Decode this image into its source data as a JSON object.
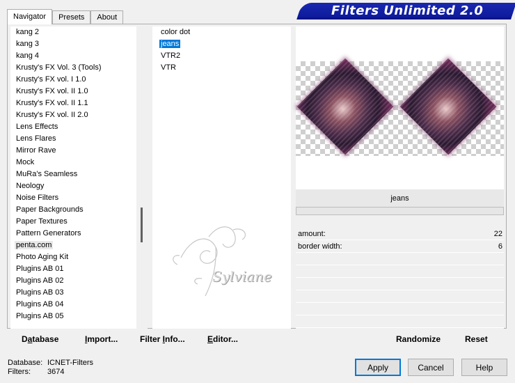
{
  "window": {
    "title": "Filters Unlimited 2.0"
  },
  "tabs": [
    {
      "label": "Navigator",
      "active": true
    },
    {
      "label": "Presets",
      "active": false
    },
    {
      "label": "About",
      "active": false
    }
  ],
  "categories": [
    "kang 2",
    "kang 3",
    "kang 4",
    "Krusty's FX Vol. 3 (Tools)",
    "Krusty's FX vol. I 1.0",
    "Krusty's FX vol. II 1.0",
    "Krusty's FX vol. II 1.1",
    "Krusty's FX vol. II 2.0",
    "Lens Effects",
    "Lens Flares",
    "Mirror Rave",
    "Mock",
    "MuRa's Seamless",
    "Neology",
    "Noise Filters",
    "Paper Backgrounds",
    "Paper Textures",
    "Pattern Generators",
    "penta.com",
    "Photo Aging Kit",
    "Plugins AB 01",
    "Plugins AB 02",
    "Plugins AB 03",
    "Plugins AB 04",
    "Plugins AB 05"
  ],
  "selected_category": "penta.com",
  "filters": [
    "color dot",
    "jeans",
    "VTR2",
    "VTR"
  ],
  "selected_filter": "jeans",
  "filter_name": "jeans",
  "params": [
    {
      "label": "amount:",
      "value": "22"
    },
    {
      "label": "border width:",
      "value": "6"
    }
  ],
  "buttons_left": [
    {
      "pre": "D",
      "ul": "a",
      "post": "tabase",
      "name": "database-button"
    },
    {
      "pre": "",
      "ul": "I",
      "post": "mport...",
      "name": "import-button"
    },
    {
      "pre": "Filter ",
      "ul": "I",
      "post": "nfo...",
      "name": "filter-info-button"
    },
    {
      "pre": "",
      "ul": "E",
      "post": "ditor...",
      "name": "editor-button"
    }
  ],
  "randomize_label": "Randomize",
  "reset_label": "Reset",
  "status": {
    "database_label": "Database:",
    "database_value": "ICNET-Filters",
    "filters_label": "Filters:",
    "filters_value": "3674"
  },
  "apply_label": "Apply",
  "cancel_label": "Cancel",
  "help_label": "Help",
  "watermark_text": "Sylviane"
}
